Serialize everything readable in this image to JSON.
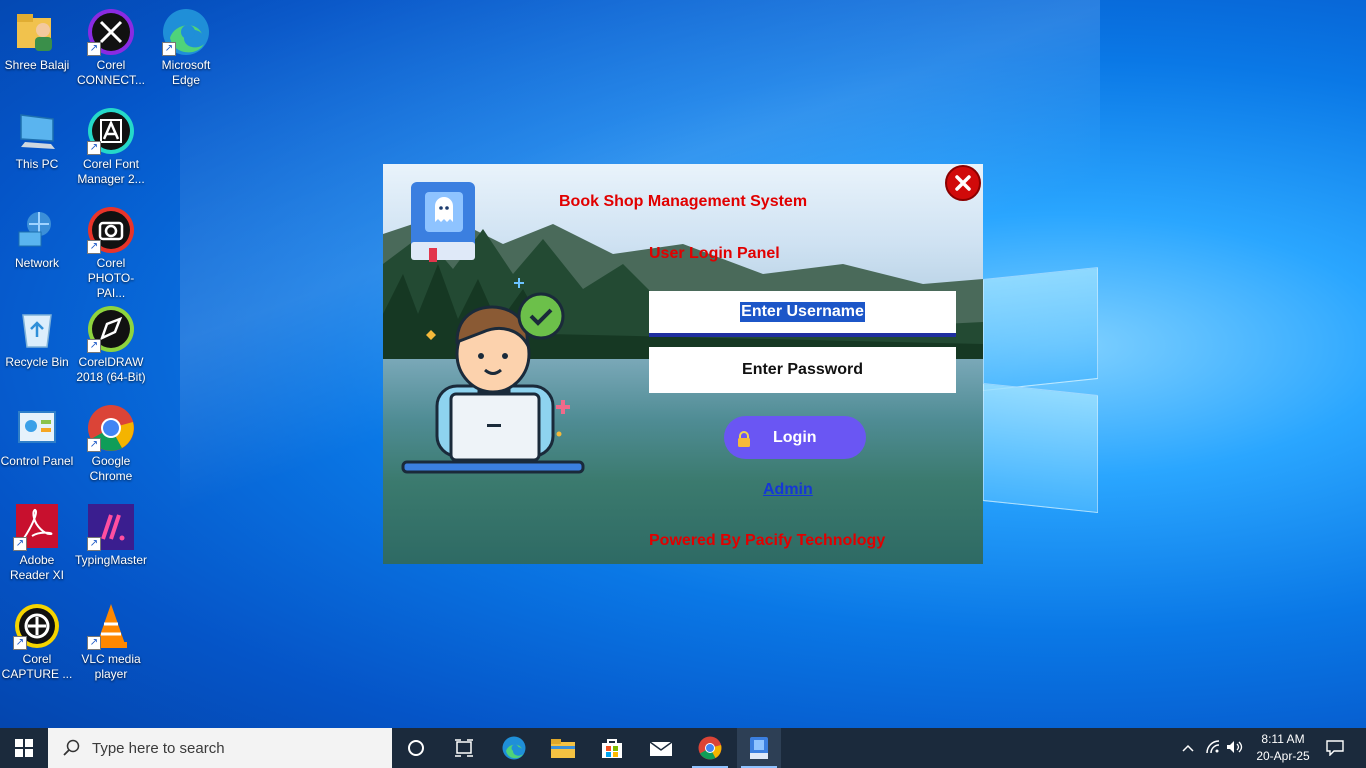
{
  "desktop": {
    "icons": [
      {
        "label": "Shree Balaji",
        "icon": "user-folder-icon"
      },
      {
        "label": "Corel CONNECT...",
        "icon": "corel-connect-icon"
      },
      {
        "label": "Microsoft Edge",
        "icon": "edge-icon"
      },
      {
        "label": "This PC",
        "icon": "computer-icon"
      },
      {
        "label": "Corel Font Manager 2...",
        "icon": "corel-font-manager-icon"
      },
      {
        "label": "Network",
        "icon": "network-icon"
      },
      {
        "label": "Corel PHOTO-PAI...",
        "icon": "corel-photo-paint-icon"
      },
      {
        "label": "Recycle Bin",
        "icon": "recycle-bin-icon"
      },
      {
        "label": "CorelDRAW 2018 (64-Bit)",
        "icon": "coreldraw-icon"
      },
      {
        "label": "Control Panel",
        "icon": "control-panel-icon"
      },
      {
        "label": "Google Chrome",
        "icon": "chrome-icon"
      },
      {
        "label": "Adobe Reader XI",
        "icon": "adobe-reader-icon"
      },
      {
        "label": "TypingMaster",
        "icon": "typingmaster-icon"
      },
      {
        "label": "Corel CAPTURE ...",
        "icon": "corel-capture-icon"
      },
      {
        "label": "VLC media player",
        "icon": "vlc-icon"
      }
    ]
  },
  "login": {
    "title": "Book Shop Management System",
    "subtitle": "User Login Panel",
    "username_text": "Enter Username",
    "password_text": "Enter Password",
    "login_label": "Login",
    "admin_link": "Admin",
    "powered_by": "Powered By Pacify Technology",
    "colors": {
      "accent_red": "#e10000",
      "button": "#6a56f3",
      "link": "#1537d6"
    }
  },
  "taskbar": {
    "search_placeholder": "Type here to search",
    "pinned": [
      "cortana-icon",
      "task-view-icon",
      "edge-icon",
      "file-explorer-icon",
      "store-icon",
      "mail-icon",
      "chrome-icon",
      "book-shop-app-icon"
    ],
    "time": "8:11 AM",
    "date": "20-Apr-25"
  }
}
